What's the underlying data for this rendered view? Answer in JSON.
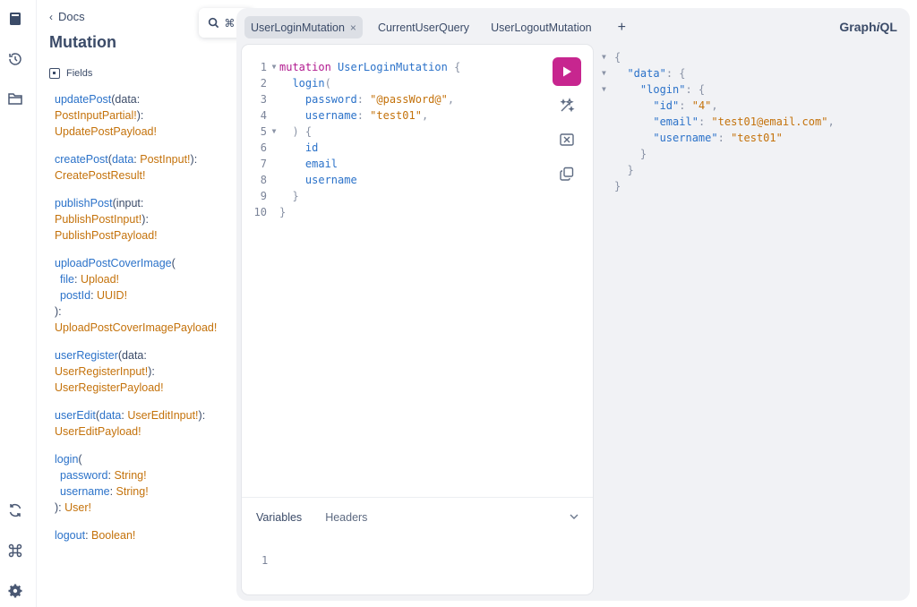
{
  "docs": {
    "back_label": "Docs",
    "title": "Mutation",
    "search_shortcut": "⌘ K",
    "fields_label": "Fields",
    "fields": [
      {
        "name": "updatePost",
        "open": "(data:",
        "args": [],
        "argline": "PostInputPartial!",
        "close": "):",
        "ret": "UpdatePostPayload!"
      },
      {
        "name": "createPost",
        "inline_arg_name": "data",
        "inline_arg_type": "PostInput!",
        "close": "):",
        "ret": "CreatePostResult!"
      },
      {
        "name": "publishPost",
        "open": "(input:",
        "argline": "PublishPostInput!",
        "close": "):",
        "ret": "PublishPostPayload!"
      },
      {
        "name": "uploadPostCoverImage",
        "open": "(",
        "args": [
          {
            "n": "file",
            "t": "Upload!"
          },
          {
            "n": "postId",
            "t": "UUID!"
          }
        ],
        "close": "):",
        "ret": "UploadPostCoverImagePayload!"
      },
      {
        "name": "userRegister",
        "open": "(data:",
        "argline": "UserRegisterInput!",
        "close": "):",
        "ret": "UserRegisterPayload!"
      },
      {
        "name": "userEdit",
        "inline_arg_name": "data",
        "inline_arg_type": "UserEditInput!",
        "close": "):",
        "ret": "UserEditPayload!"
      },
      {
        "name": "login",
        "open": "(",
        "args": [
          {
            "n": "password",
            "t": "String!"
          },
          {
            "n": "username",
            "t": "String!"
          }
        ],
        "close": "):",
        "ret": "User!"
      },
      {
        "name": "logout",
        "ret": "Boolean!"
      }
    ]
  },
  "tabs": [
    {
      "label": "UserLoginMutation",
      "active": true
    },
    {
      "label": "CurrentUserQuery",
      "active": false
    },
    {
      "label": "UserLogoutMutation",
      "active": false
    }
  ],
  "tab_add": "+",
  "tab_close": "×",
  "logo": {
    "pre": "Graph",
    "italic": "i",
    "post": "QL"
  },
  "editor": {
    "line_numbers": [
      "1",
      "2",
      "3",
      "4",
      "5",
      "6",
      "7",
      "8",
      "9",
      "10"
    ],
    "kw_mutation": "mutation",
    "op_name": "UserLoginMutation",
    "field_login": "login",
    "arg_password": "password",
    "val_password": "\"@passWord@\"",
    "arg_username": "username",
    "val_username": "\"test01\"",
    "sel_id": "id",
    "sel_email": "email",
    "sel_username": "username"
  },
  "variables": {
    "tab_variables": "Variables",
    "tab_headers": "Headers",
    "line_number": "1"
  },
  "result": {
    "key_data": "\"data\"",
    "key_login": "\"login\"",
    "key_id": "\"id\"",
    "val_id": "\"4\"",
    "key_email": "\"email\"",
    "val_email": "\"test01@email.com\"",
    "key_username": "\"username\"",
    "val_username": "\"test01\""
  },
  "colors": {
    "accent_run": "#c7268f",
    "keyword": "#b11a8f",
    "field": "#2b72c9",
    "type": "#c4720b"
  }
}
